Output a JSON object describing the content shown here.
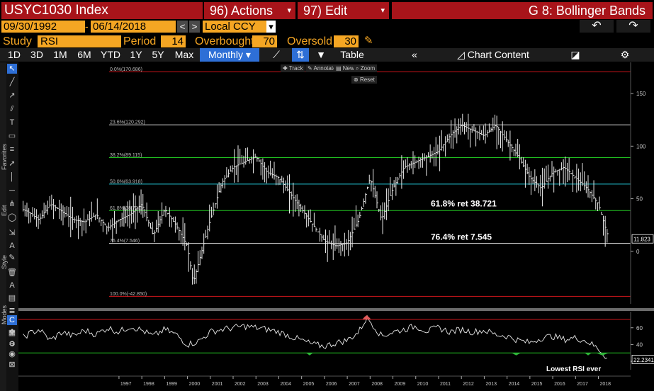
{
  "header": {
    "ticker": "USYC1030 Index",
    "actions_label": "96) Actions",
    "edit_label": "97) Edit",
    "graph_title": "G 8: Bollinger Bands"
  },
  "params": {
    "start_date": "09/30/1992",
    "end_date": "06/14/2018",
    "currency": "Local CCY",
    "study_label": "Study",
    "study_value": "RSI",
    "period_label": "Period",
    "period_value": "14",
    "overbought_label": "Overbought",
    "overbought_value": "70",
    "oversold_label": "Oversold",
    "oversold_value": "30"
  },
  "toolbar": {
    "ranges": [
      "1D",
      "3D",
      "1M",
      "6M",
      "YTD",
      "1Y",
      "5Y",
      "Max"
    ],
    "frequency": "Monthly",
    "table_label": "Table",
    "chart_content_label": "Chart Content"
  },
  "chart_tools": {
    "track": "Track",
    "annotate": "Annotate",
    "news": "News",
    "zoom": "Zoom",
    "reset": "Reset"
  },
  "side_labels": {
    "favorites": "Favorites",
    "edit": "Edit",
    "style": "Style",
    "modes": "Modes"
  },
  "chart_data": [
    {
      "type": "line",
      "y_axis_ticks": [
        150,
        100,
        50,
        0
      ],
      "ylim": [
        -50,
        175
      ],
      "last_value_label": "11.823",
      "fib_levels": [
        {
          "label": "0.0%(170.686)",
          "value": 170.686,
          "color": "#d0161b"
        },
        {
          "label": "23.6%(120.292)",
          "value": 120.292,
          "color": "#d9d9d9"
        },
        {
          "label": "38.2%(89.115)",
          "value": 89.115,
          "color": "#22c422"
        },
        {
          "label": "50.0%(63.918)",
          "value": 63.918,
          "color": "#23c4d4"
        },
        {
          "label": "61.8%(38.721)",
          "value": 38.721,
          "color": "#22c422"
        },
        {
          "label": "76.4%(7.546)",
          "value": 7.546,
          "color": "#d9d9d9"
        },
        {
          "label": "100.0%(-42.850)",
          "value": -42.85,
          "color": "#d0161b"
        }
      ],
      "annotations": [
        "61.8% ret 38.721",
        "76.4% ret 7.545"
      ],
      "x": [
        1992.75,
        1993,
        1993.5,
        1994,
        1994.5,
        1995,
        1995.5,
        1996,
        1996.5,
        1997,
        1997.5,
        1998,
        1998.5,
        1999,
        1999.5,
        2000,
        2000.25,
        2000.5,
        2001,
        2001.5,
        2002,
        2002.5,
        2003,
        2003.5,
        2004,
        2004.5,
        2005,
        2005.5,
        2006,
        2006.5,
        2007,
        2007.5,
        2008,
        2008.5,
        2009,
        2009.5,
        2010,
        2010.5,
        2011,
        2011.5,
        2012,
        2012.5,
        2013,
        2013.5,
        2014,
        2014.5,
        2015,
        2015.5,
        2016,
        2016.5,
        2017,
        2017.5,
        2018,
        2018.45
      ],
      "series": [
        {
          "values": [
            40,
            38,
            30,
            45,
            38,
            30,
            28,
            35,
            22,
            30,
            35,
            45,
            15,
            40,
            25,
            5,
            -30,
            -10,
            30,
            65,
            80,
            85,
            90,
            75,
            70,
            55,
            40,
            25,
            10,
            5,
            8,
            30,
            70,
            30,
            60,
            80,
            85,
            90,
            95,
            110,
            120,
            115,
            110,
            120,
            105,
            90,
            70,
            60,
            75,
            80,
            70,
            60,
            45,
            11.8
          ]
        }
      ]
    },
    {
      "type": "line",
      "name": "RSI",
      "y_axis_ticks": [
        60,
        40,
        20
      ],
      "ylim": [
        15,
        75
      ],
      "overbought": 70,
      "oversold": 30,
      "last_value_label": "22.2341",
      "annotations": [
        "Lowest RSI ever"
      ],
      "x": [
        1992.75,
        1993,
        1993.5,
        1994,
        1994.5,
        1995,
        1995.5,
        1996,
        1996.5,
        1997,
        1997.5,
        1998,
        1998.5,
        1999,
        1999.5,
        2000,
        2000.5,
        2001,
        2001.5,
        2002,
        2002.5,
        2003,
        2003.5,
        2004,
        2004.5,
        2005,
        2005.5,
        2006,
        2006.5,
        2007,
        2007.5,
        2007.85,
        2008,
        2008.5,
        2009,
        2009.5,
        2010,
        2010.5,
        2011,
        2011.5,
        2012,
        2012.5,
        2013,
        2013.5,
        2014,
        2014.5,
        2015,
        2015.5,
        2016,
        2016.5,
        2017,
        2017.5,
        2018,
        2018.45
      ],
      "series": [
        {
          "values": [
            48,
            52,
            58,
            45,
            55,
            50,
            57,
            52,
            60,
            55,
            62,
            57,
            50,
            58,
            52,
            40,
            44,
            55,
            58,
            60,
            62,
            60,
            58,
            55,
            50,
            45,
            40,
            38,
            42,
            45,
            55,
            72,
            68,
            50,
            55,
            58,
            62,
            56,
            60,
            55,
            58,
            55,
            57,
            52,
            50,
            45,
            42,
            48,
            50,
            46,
            48,
            44,
            35,
            22.2
          ]
        }
      ]
    }
  ],
  "x_axis_labels": [
    "1997",
    "1998",
    "1999",
    "2000",
    "2001",
    "2002",
    "2003",
    "2004",
    "2005",
    "2006",
    "2007",
    "2008",
    "2009",
    "2010",
    "2011",
    "2012",
    "2013",
    "2014",
    "2015",
    "2016",
    "2017",
    "2018"
  ]
}
